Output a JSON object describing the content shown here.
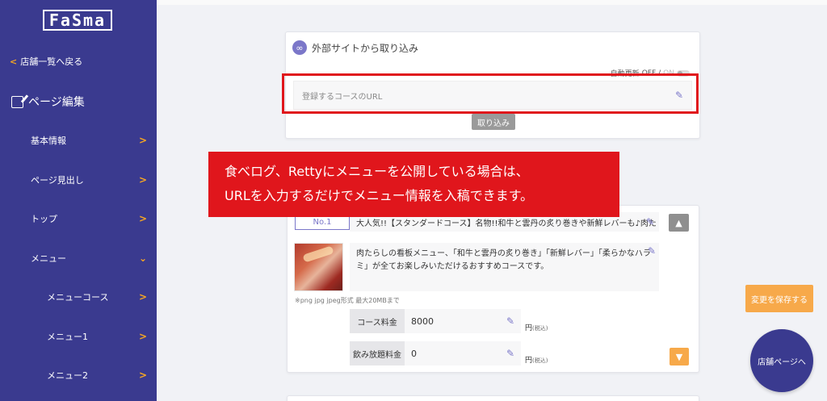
{
  "sidebar": {
    "logo": "FaSma",
    "back_link": "店舗一覧へ戻る",
    "section_title": "ページ編集",
    "items": [
      {
        "label": "基本情報"
      },
      {
        "label": "ページ見出し"
      },
      {
        "label": "トップ"
      },
      {
        "label": "メニュー"
      },
      {
        "label": "メニューコース"
      },
      {
        "label": "メニュー1"
      },
      {
        "label": "メニュー2"
      }
    ]
  },
  "import_card": {
    "title": "外部サイトから取り込み",
    "auto_update_label": "自動更新",
    "auto_off": "OFF",
    "auto_sep": "/",
    "auto_on": "ON",
    "url_placeholder": "登録するコースのURL",
    "import_button": "取り込み"
  },
  "banner": {
    "line1": "食べログ、Rettyにメニューを公開している場合は、",
    "line2": "URLを入力するだけでメニュー情報を入稿できます。"
  },
  "course": {
    "badge": "No.1",
    "name": "大人気!!【スタンダードコース】名物!!和牛と雲丹の炙り巻きや新鮮レバーも♪肉た",
    "description": "肉たらしの看板メニュー、「和牛と雲丹の炙り巻き」「新鮮レバー」「柔らかなハラミ」が全てお楽しみいただけるおすすめコースです。",
    "file_note": "※png jpg jpeg形式 最大20MBまで",
    "price_label": "コース料金",
    "price_value": "8000",
    "drink_label": "飲み放題料金",
    "drink_value": "0",
    "unit": "円",
    "tax": "(税込)"
  },
  "actions": {
    "save": "変更を保存する",
    "store_page": "店舗ページへ"
  },
  "colors": {
    "sidebar": "#3a3a8f",
    "accent": "#f7a94a",
    "highlight": "#e0161c",
    "icon": "#7b77c9"
  }
}
